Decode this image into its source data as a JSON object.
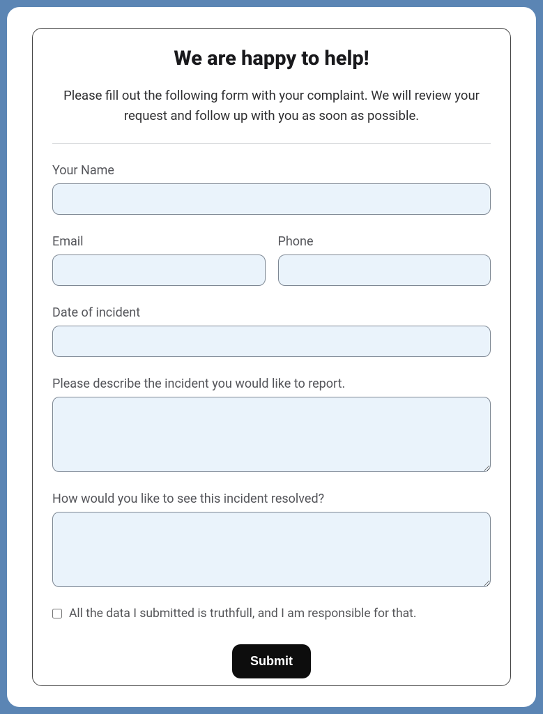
{
  "form": {
    "title": "We are happy to help!",
    "intro": "Please fill out the following form with your complaint. We will review your request and follow up with you as soon as possible.",
    "fields": {
      "name": {
        "label": "Your Name",
        "value": ""
      },
      "email": {
        "label": "Email",
        "value": ""
      },
      "phone": {
        "label": "Phone",
        "value": ""
      },
      "date": {
        "label": "Date of incident",
        "value": ""
      },
      "describe": {
        "label": "Please describe the incident you would like to report.",
        "value": ""
      },
      "resolution": {
        "label": "How would you like to see this incident resolved?",
        "value": ""
      }
    },
    "consent": {
      "label": "All the data I submitted is truthfull, and I am responsible for that.",
      "checked": false
    },
    "submit_label": "Submit"
  },
  "colors": {
    "page_bg": "#5b85b4",
    "card_bg": "#ffffff",
    "input_bg": "#eaf3fb",
    "input_border": "#7e8894",
    "label_text": "#54555a",
    "submit_bg": "#0d0d0d",
    "submit_text": "#ffffff"
  }
}
